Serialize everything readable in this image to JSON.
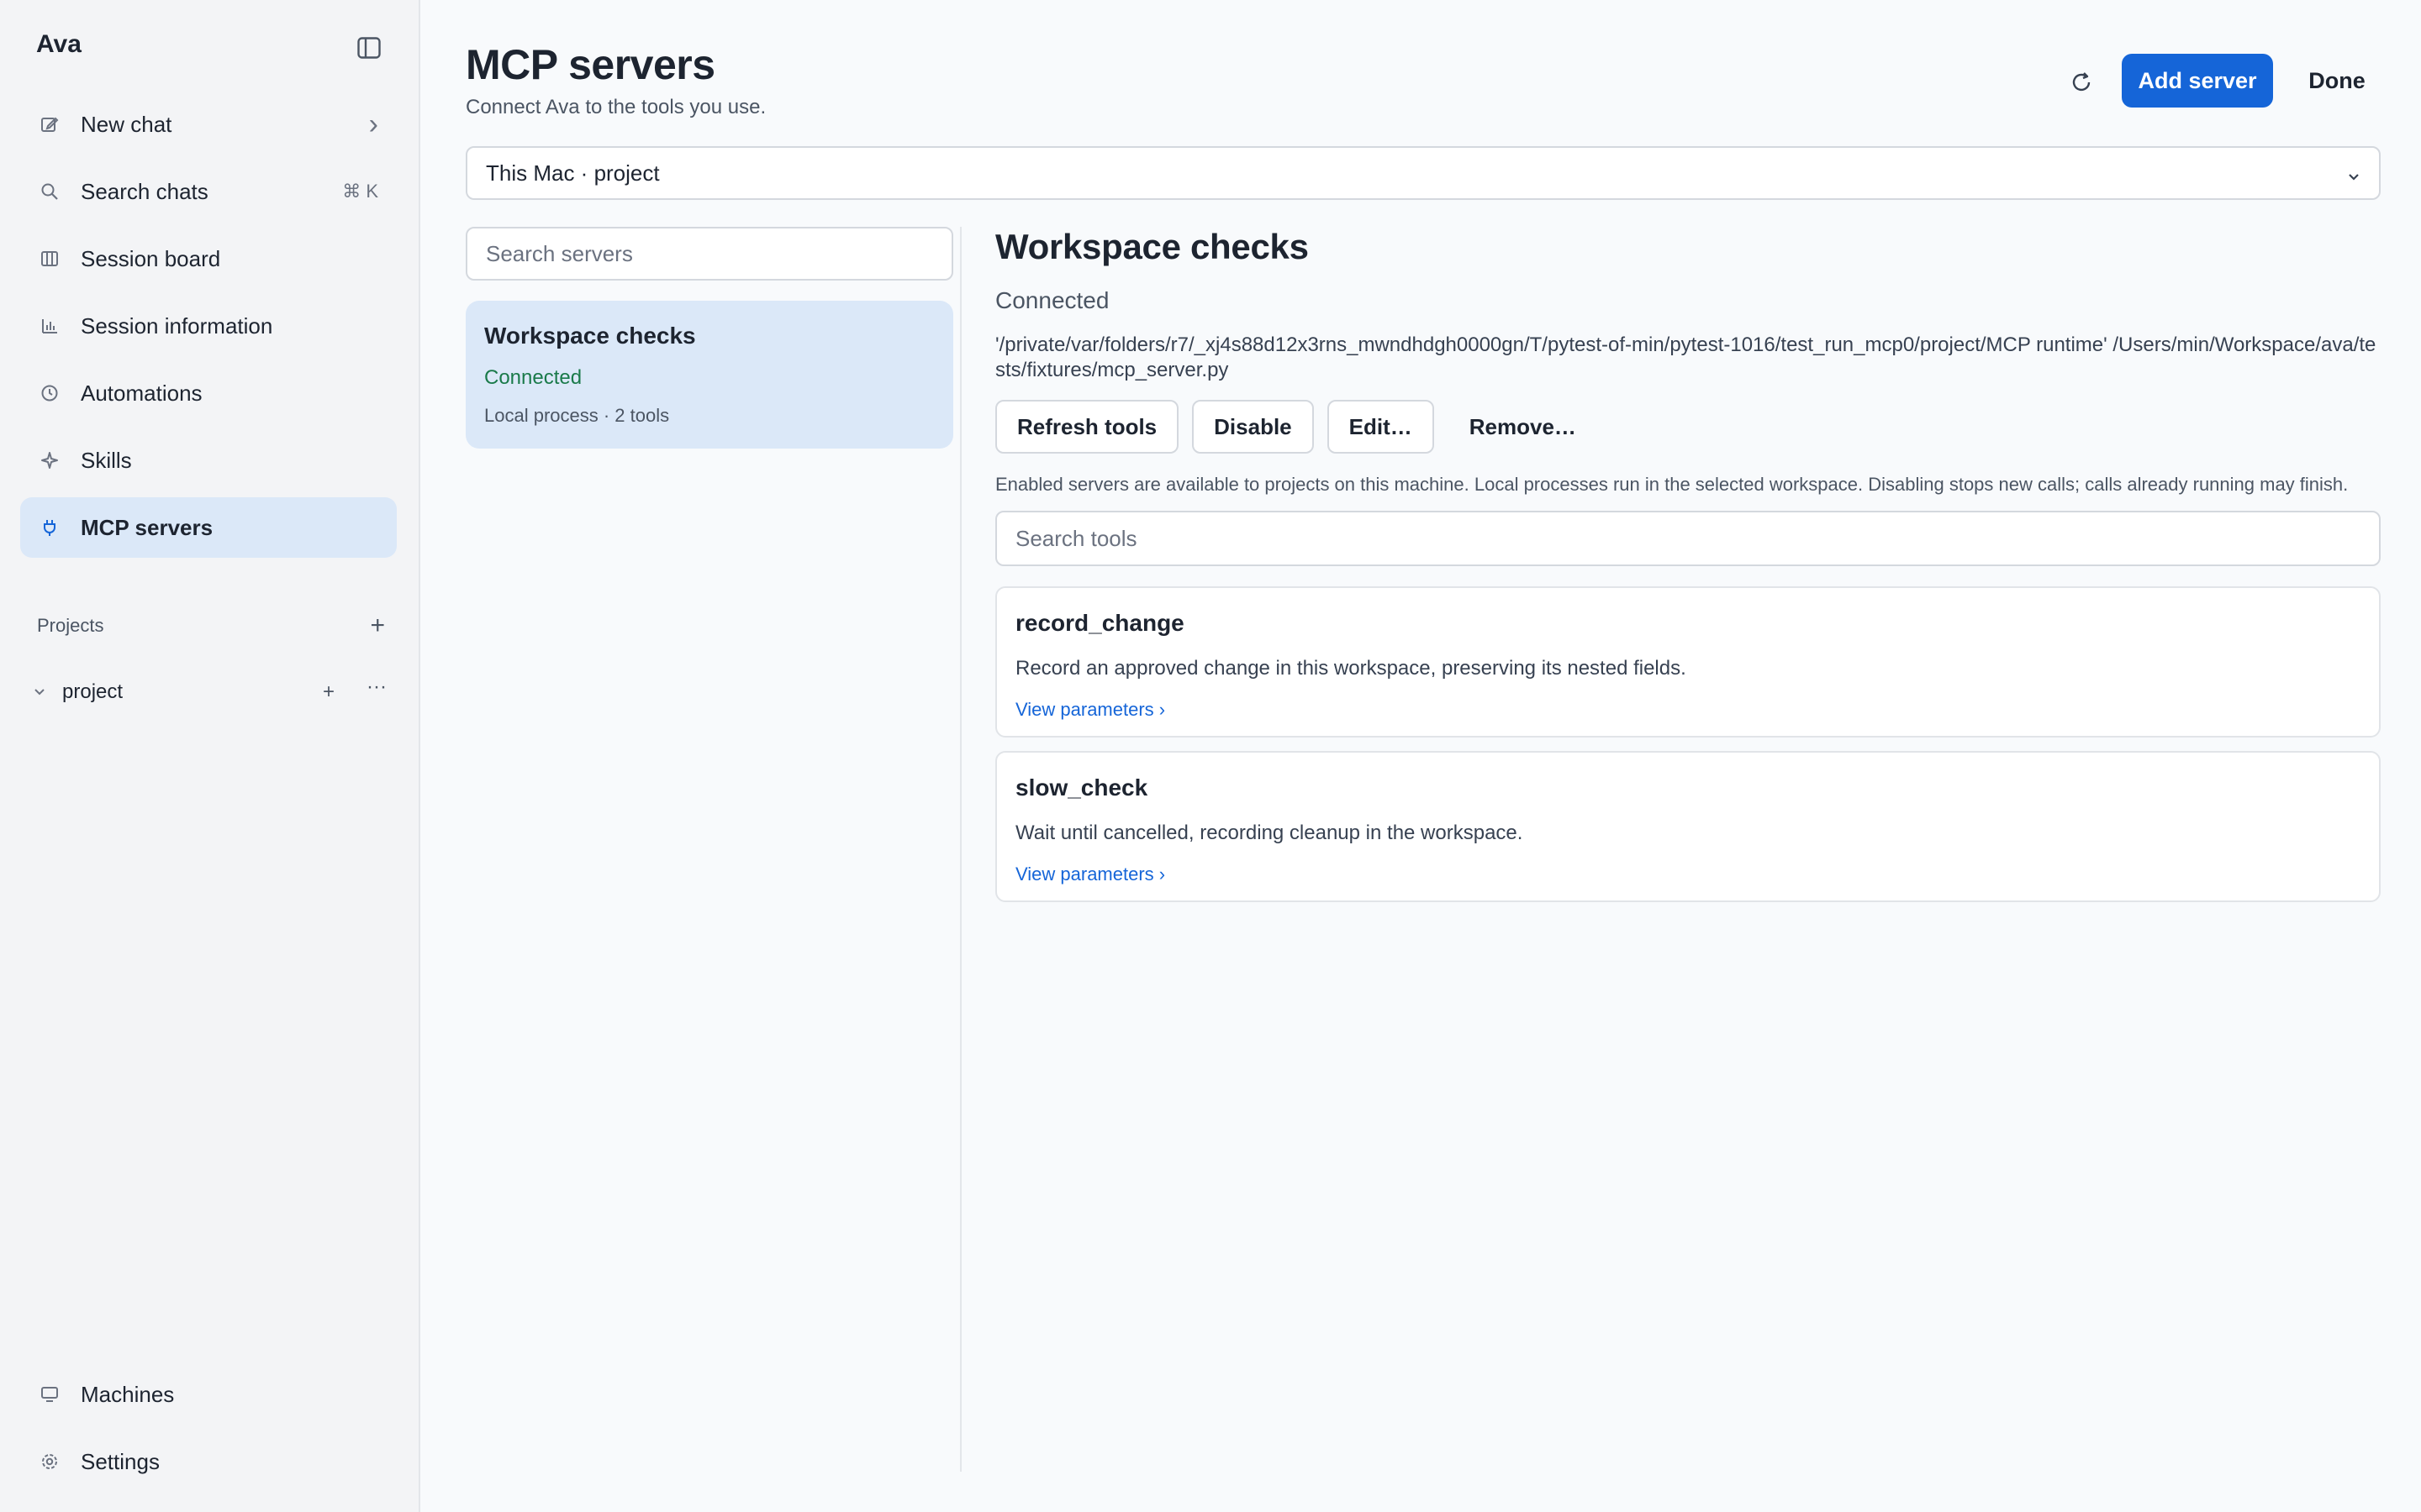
{
  "app": {
    "title": "Ava"
  },
  "sidebar": {
    "items": [
      {
        "label": "New chat",
        "icon": "compose-icon",
        "trail": "›"
      },
      {
        "label": "Search chats",
        "icon": "search-icon",
        "trail": "⌘ K"
      },
      {
        "label": "Session board",
        "icon": "board-icon",
        "trail": ""
      },
      {
        "label": "Session information",
        "icon": "bar-chart-icon",
        "trail": ""
      },
      {
        "label": "Automations",
        "icon": "clock-icon",
        "trail": ""
      },
      {
        "label": "Skills",
        "icon": "sparkle-icon",
        "trail": ""
      },
      {
        "label": "MCP servers",
        "icon": "plug-icon",
        "trail": "",
        "active": true
      }
    ],
    "projects_label": "Projects",
    "projects": [
      {
        "name": "project"
      }
    ],
    "bottom_items": [
      {
        "label": "Machines",
        "icon": "monitor-icon"
      },
      {
        "label": "Settings",
        "icon": "gear-icon"
      }
    ]
  },
  "header": {
    "title": "MCP servers",
    "subtitle": "Connect Ava to the tools you use.",
    "add_label": "Add server",
    "done_label": "Done"
  },
  "scope": {
    "value": "This Mac · project"
  },
  "server_list": {
    "search_placeholder": "Search servers",
    "servers": [
      {
        "name": "Workspace checks",
        "status": "Connected",
        "meta": "Local process · 2 tools"
      }
    ]
  },
  "detail": {
    "title": "Workspace checks",
    "status": "Connected",
    "command": "'/private/var/folders/r7/_xj4s88d12x3rns_mwndhdgh0000gn/T/pytest-of-min/pytest-1016/test_run_mcp0/project/MCP runtime' /Users/min/Workspace/ava/tests/fixtures/mcp_server.py",
    "actions": {
      "refresh": "Refresh tools",
      "disable": "Disable",
      "edit": "Edit…",
      "remove": "Remove…"
    },
    "note": "Enabled servers are available to projects on this machine. Local processes run in the selected workspace. Disabling stops new calls; calls already running may finish.",
    "tool_search_placeholder": "Search tools",
    "tools": [
      {
        "name": "record_change",
        "description": "Record an approved change in this workspace, preserving its nested fields.",
        "link": "View parameters ›"
      },
      {
        "name": "slow_check",
        "description": "Wait until cancelled, recording cleanup in the workspace.",
        "link": "View parameters ›"
      }
    ]
  },
  "colors": {
    "accent": "#1565d8",
    "active_bg": "#dbe8f8",
    "connected": "#1a7a4a"
  }
}
